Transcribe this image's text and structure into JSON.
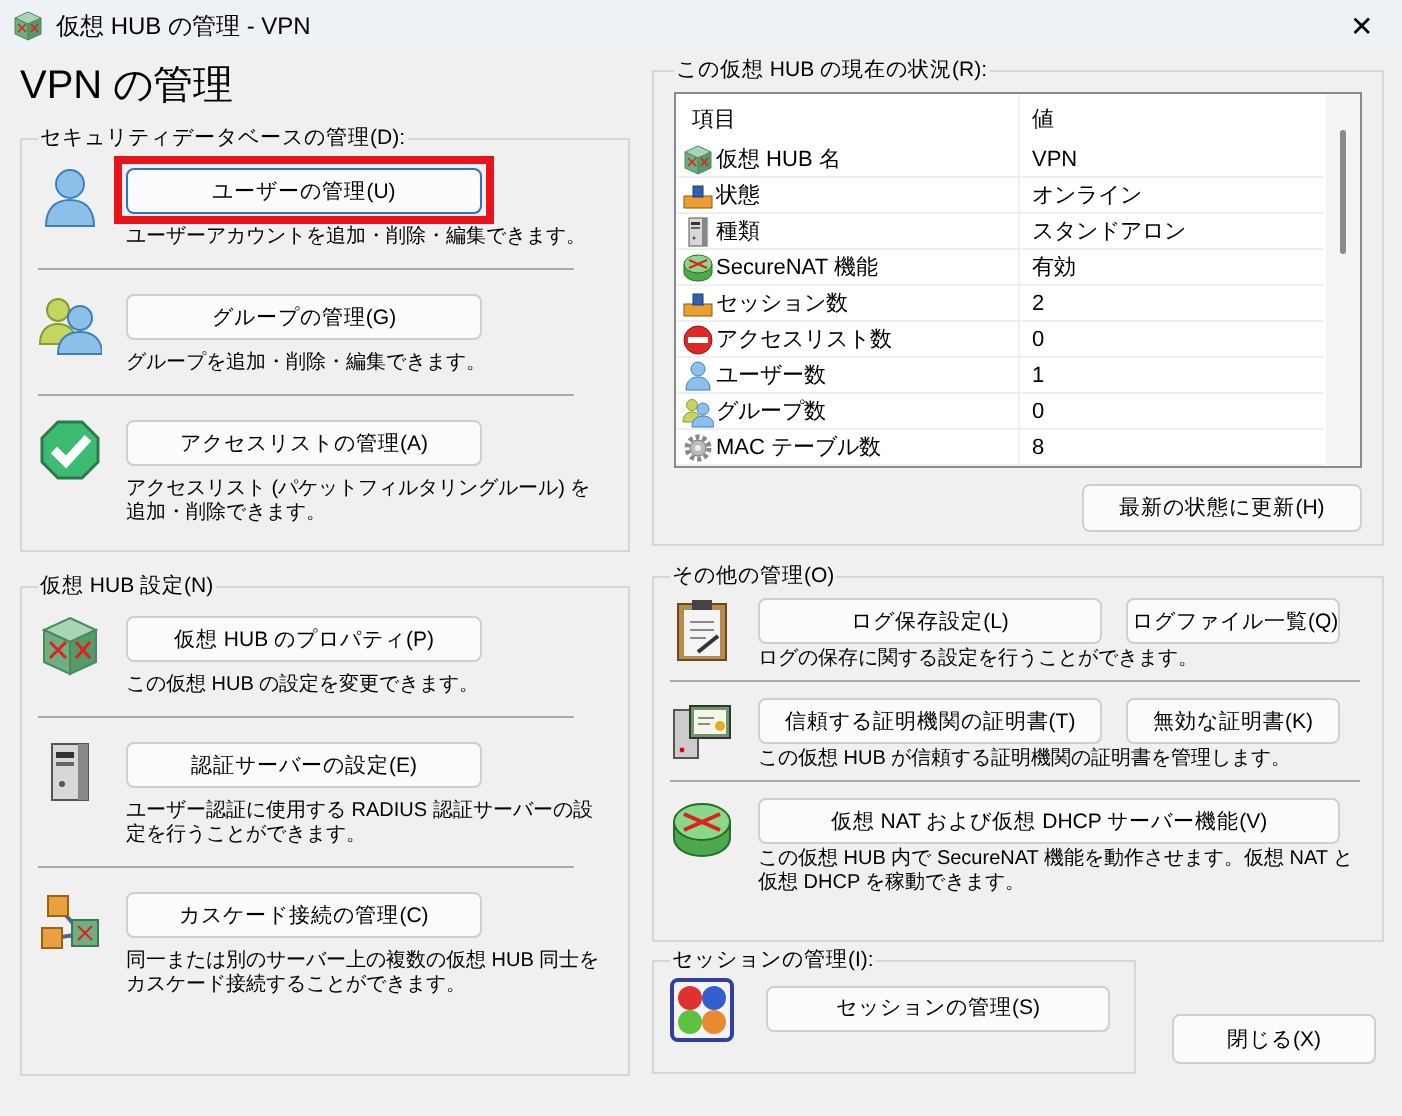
{
  "window": {
    "title": "仮想 HUB の管理 - VPN",
    "close": "✕"
  },
  "heading": "VPN の管理",
  "security": {
    "title": "セキュリティデータベースの管理(D):",
    "items": [
      {
        "kind": "user",
        "button": "ユーザーの管理(U)",
        "description": "ユーザーアカウントを追加・削除・編集できます。",
        "highlighted": true
      },
      {
        "kind": "group",
        "button": "グループの管理(G)",
        "description": "グループを追加・削除・編集できます。",
        "highlighted": false
      },
      {
        "kind": "check",
        "button": "アクセスリストの管理(A)",
        "description": "アクセスリスト (パケットフィルタリングルール) を追加・削除できます。",
        "highlighted": false
      }
    ]
  },
  "hub_settings": {
    "title": "仮想 HUB 設定(N)",
    "items": [
      {
        "kind": "hub",
        "button": "仮想 HUB のプロパティ(P)",
        "description": "この仮想 HUB の設定を変更できます。"
      },
      {
        "kind": "server",
        "button": "認証サーバーの設定(E)",
        "description": "ユーザー認証に使用する RADIUS 認証サーバーの設定を行うことができます。"
      },
      {
        "kind": "cascade",
        "button": "カスケード接続の管理(C)",
        "description": "同一または別のサーバー上の複数の仮想 HUB 同士をカスケード接続することができます。"
      }
    ]
  },
  "status": {
    "title": "この仮想 HUB の現在の状況(R):",
    "columns": [
      "項目",
      "値"
    ],
    "rows": [
      {
        "kind": "hub",
        "item": "仮想 HUB 名",
        "value": "VPN"
      },
      {
        "kind": "device",
        "item": "状態",
        "value": "オンライン"
      },
      {
        "kind": "server",
        "item": "種類",
        "value": "スタンドアロン"
      },
      {
        "kind": "nat",
        "item": "SecureNAT 機能",
        "value": "有効"
      },
      {
        "kind": "device",
        "item": "セッション数",
        "value": "2"
      },
      {
        "kind": "block",
        "item": "アクセスリスト数",
        "value": "0"
      },
      {
        "kind": "user",
        "item": "ユーザー数",
        "value": "1"
      },
      {
        "kind": "group",
        "item": "グループ数",
        "value": "0"
      },
      {
        "kind": "gear",
        "item": "MAC テーブル数",
        "value": "8"
      }
    ],
    "refresh_button": "最新の状態に更新(H)"
  },
  "other": {
    "title": "その他の管理(O)",
    "items": [
      {
        "kind": "log",
        "buttons": [
          "ログ保存設定(L)",
          "ログファイル一覧(Q)"
        ],
        "description": "ログの保存に関する設定を行うことができます。"
      },
      {
        "kind": "cert",
        "buttons": [
          "信頼する証明機関の証明書(T)",
          "無効な証明書(K)"
        ],
        "description": "この仮想 HUB が信頼する証明機関の証明書を管理します。"
      },
      {
        "kind": "nat",
        "buttons": [
          "仮想 NAT および仮想 DHCP サーバー機能(V)"
        ],
        "description": "この仮想 HUB 内で SecureNAT 機能を動作させます。仮想 NAT と仮想 DHCP を稼動できます。"
      }
    ]
  },
  "session": {
    "title": "セッションの管理(I):",
    "kind": "session",
    "button": "セッションの管理(S)"
  },
  "close_button": "閉じる(X)"
}
